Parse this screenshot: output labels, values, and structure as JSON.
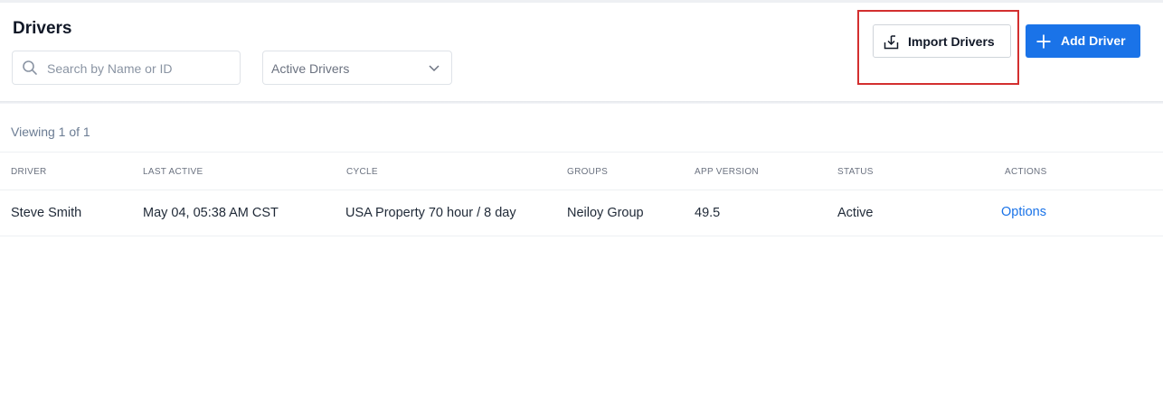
{
  "page": {
    "title": "Drivers"
  },
  "filters": {
    "search_placeholder": "Search by Name or ID",
    "status_selected": "Active Drivers"
  },
  "actions": {
    "import_label": "Import Drivers",
    "add_label": "Add Driver"
  },
  "colors": {
    "primary": "#1a73e8",
    "highlight_border": "#d32f2f"
  },
  "table": {
    "viewing": "Viewing 1 of 1",
    "columns": [
      "DRIVER",
      "LAST ACTIVE",
      "CYCLE",
      "GROUPS",
      "APP VERSION",
      "STATUS",
      "ACTIONS"
    ],
    "rows": [
      {
        "driver": "Steve Smith",
        "last_active": "May 04, 05:38 AM CST",
        "cycle": "USA Property 70 hour / 8 day",
        "groups": "Neiloy Group",
        "app_version": "49.5",
        "status": "Active",
        "actions": "Options"
      }
    ]
  }
}
